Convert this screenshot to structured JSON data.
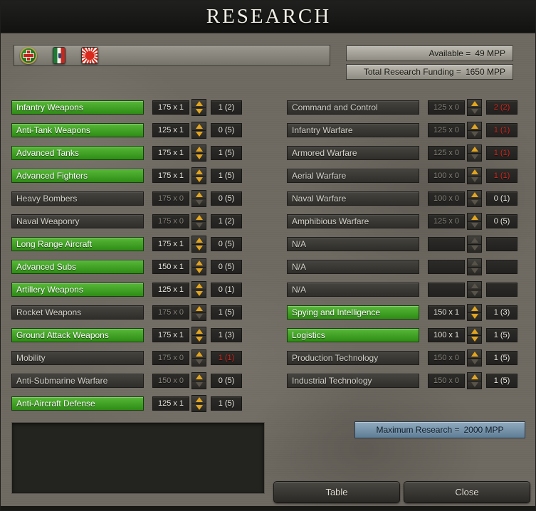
{
  "window": {
    "title": "RESEARCH"
  },
  "colors": {
    "researched_green": "#3fae2a",
    "arrow_gold": "#e2a51e",
    "maxed_red": "#d3271c",
    "maximum_box_blue": "#7494ab",
    "background_stone": "#6f6b63"
  },
  "icons": {
    "flags": [
      "green-cross-roundel-flag",
      "italy-tricolor-flag",
      "japan-rising-sun-flag"
    ],
    "spinner_up": "up-arrow",
    "spinner_down": "down-arrow"
  },
  "top": {
    "available": {
      "label": "Available =",
      "value": "49 MPP"
    },
    "funding": {
      "label": "Total Research Funding =",
      "value": "1650 MPP"
    }
  },
  "research_left": [
    {
      "label": "Infantry Weapons",
      "green": true,
      "na": false,
      "level": 1,
      "cost": "175 x 1",
      "count": "1 (2)",
      "red": false
    },
    {
      "label": "Anti-Tank Weapons",
      "green": true,
      "na": false,
      "level": 1,
      "cost": "125 x 1",
      "count": "0 (5)",
      "red": false
    },
    {
      "label": "Advanced Tanks",
      "green": true,
      "na": false,
      "level": 1,
      "cost": "175 x 1",
      "count": "1 (5)",
      "red": false
    },
    {
      "label": "Advanced Fighters",
      "green": true,
      "na": false,
      "level": 1,
      "cost": "175 x 1",
      "count": "1 (5)",
      "red": false
    },
    {
      "label": "Heavy Bombers",
      "green": false,
      "na": false,
      "level": 0,
      "cost": "175 x 0",
      "count": "0 (5)",
      "red": false
    },
    {
      "label": "Naval Weaponry",
      "green": false,
      "na": false,
      "level": 0,
      "cost": "175 x 0",
      "count": "1 (2)",
      "red": false
    },
    {
      "label": "Long Range Aircraft",
      "green": true,
      "na": false,
      "level": 1,
      "cost": "175 x 1",
      "count": "0 (5)",
      "red": false
    },
    {
      "label": "Advanced Subs",
      "green": true,
      "na": false,
      "level": 1,
      "cost": "150 x 1",
      "count": "0 (5)",
      "red": false
    },
    {
      "label": "Artillery Weapons",
      "green": true,
      "na": false,
      "level": 1,
      "cost": "125 x 1",
      "count": "0 (1)",
      "red": false
    },
    {
      "label": "Rocket Weapons",
      "green": false,
      "na": false,
      "level": 0,
      "cost": "175 x 0",
      "count": "1 (5)",
      "red": false
    },
    {
      "label": "Ground Attack Weapons",
      "green": true,
      "na": false,
      "level": 1,
      "cost": "175 x 1",
      "count": "1 (3)",
      "red": false
    },
    {
      "label": "Mobility",
      "green": false,
      "na": false,
      "level": 0,
      "cost": "175 x 0",
      "count": "1 (1)",
      "red": true
    },
    {
      "label": "Anti-Submarine Warfare",
      "green": false,
      "na": false,
      "level": 0,
      "cost": "150 x 0",
      "count": "0 (5)",
      "red": false
    },
    {
      "label": "Anti-Aircraft Defense",
      "green": true,
      "na": false,
      "level": 1,
      "cost": "125 x 1",
      "count": "1 (5)",
      "red": false
    }
  ],
  "research_right": [
    {
      "label": "Command and Control",
      "green": false,
      "na": false,
      "level": 0,
      "cost": "125 x 0",
      "count": "2 (2)",
      "red": true
    },
    {
      "label": "Infantry Warfare",
      "green": false,
      "na": false,
      "level": 0,
      "cost": "125 x 0",
      "count": "1 (1)",
      "red": true
    },
    {
      "label": "Armored Warfare",
      "green": false,
      "na": false,
      "level": 0,
      "cost": "125 x 0",
      "count": "1 (1)",
      "red": true
    },
    {
      "label": "Aerial Warfare",
      "green": false,
      "na": false,
      "level": 0,
      "cost": "100 x 0",
      "count": "1 (1)",
      "red": true
    },
    {
      "label": "Naval Warfare",
      "green": false,
      "na": false,
      "level": 0,
      "cost": "100 x 0",
      "count": "0 (1)",
      "red": false
    },
    {
      "label": "Amphibious Warfare",
      "green": false,
      "na": false,
      "level": 0,
      "cost": "125 x 0",
      "count": "0 (5)",
      "red": false
    },
    {
      "label": "N/A",
      "green": false,
      "na": true,
      "cost": "",
      "count": "",
      "red": false
    },
    {
      "label": "N/A",
      "green": false,
      "na": true,
      "cost": "",
      "count": "",
      "red": false
    },
    {
      "label": "N/A",
      "green": false,
      "na": true,
      "cost": "",
      "count": "",
      "red": false
    },
    {
      "label": "Spying and Intelligence",
      "green": true,
      "na": false,
      "level": 1,
      "cost": "150 x 1",
      "count": "1 (3)",
      "red": false
    },
    {
      "label": "Logistics",
      "green": true,
      "na": false,
      "level": 1,
      "cost": "100 x 1",
      "count": "1 (5)",
      "red": false
    },
    {
      "label": "Production Technology",
      "green": false,
      "na": false,
      "level": 0,
      "cost": "150 x 0",
      "count": "1 (5)",
      "red": false
    },
    {
      "label": "Industrial Technology",
      "green": false,
      "na": false,
      "level": 0,
      "cost": "150 x 0",
      "count": "1 (5)",
      "red": false
    }
  ],
  "bottom": {
    "maximum": {
      "label": "Maximum Research =",
      "value": "2000 MPP"
    }
  },
  "buttons": {
    "table": "Table",
    "close": "Close"
  }
}
